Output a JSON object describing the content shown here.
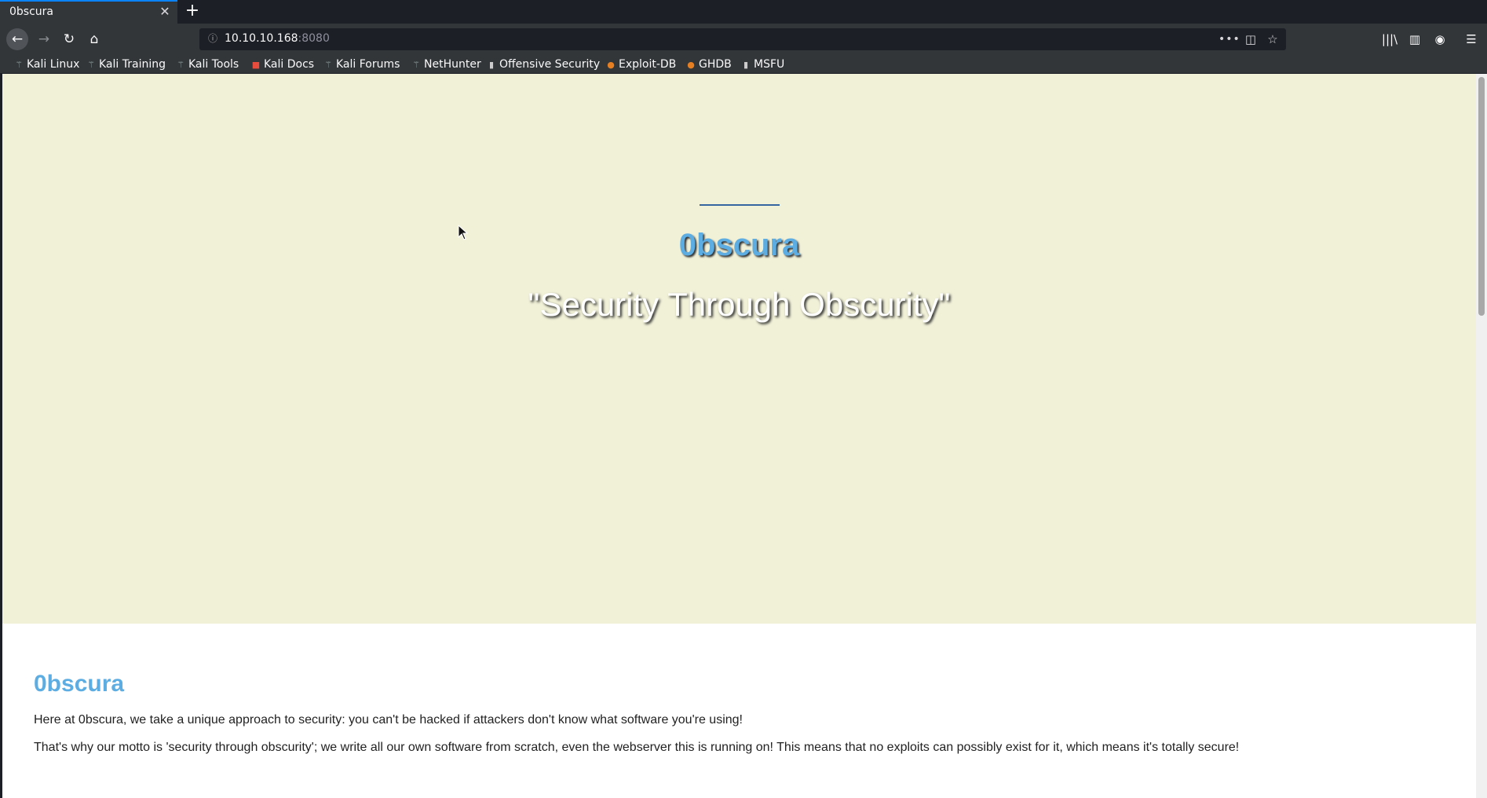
{
  "tab": {
    "title": "0bscura",
    "close": "✕",
    "new_tab": "+"
  },
  "nav": {
    "back": "←",
    "forward": "→",
    "reload": "↻",
    "home": "⌂",
    "url_host": "10.10.10.168",
    "url_port": ":8080",
    "info_icon": "ⓘ",
    "more": "•••",
    "pocket": "◫",
    "star": "☆",
    "library": "|||\\",
    "sidebar": "▥",
    "account": "◉",
    "menu": "☰"
  },
  "bookmarks": [
    {
      "label": "Kali Linux",
      "icon": "dragon-icon"
    },
    {
      "label": "Kali Training",
      "icon": "dragon-icon"
    },
    {
      "label": "Kali Tools",
      "icon": "dragon-icon"
    },
    {
      "label": "Kali Docs",
      "icon": "docs-icon"
    },
    {
      "label": "Kali Forums",
      "icon": "dragon-icon"
    },
    {
      "label": "NetHunter",
      "icon": "dragon-icon"
    },
    {
      "label": "Offensive Security",
      "icon": "offsec-icon"
    },
    {
      "label": "Exploit-DB",
      "icon": "exploitdb-icon"
    },
    {
      "label": "GHDB",
      "icon": "exploitdb-icon"
    },
    {
      "label": "MSFU",
      "icon": "offsec-icon"
    }
  ],
  "page": {
    "hero_title": "0bscura",
    "hero_motto": "\"Security Through Obscurity\"",
    "section_title": "0bscura",
    "paragraphs": [
      "Here at 0bscura, we take a unique approach to security: you can't be hacked if attackers don't know what software you're using!",
      "That's why our motto is 'security through obscurity'; we write all our own software from scratch, even the webserver this is running on! This means that no exploits can possibly exist for it, which means it's totally secure!"
    ]
  },
  "colors": {
    "hero_bg": "#f1f1d8",
    "accent": "#5dade2",
    "rule": "#3566a2",
    "chrome": "#323639"
  }
}
